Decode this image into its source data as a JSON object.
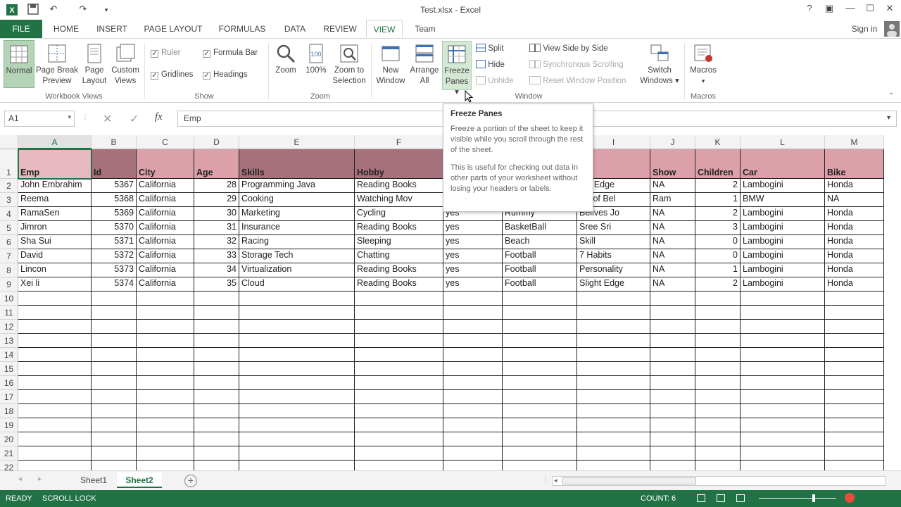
{
  "window": {
    "title": "Test.xlsx - Excel"
  },
  "qat": {
    "undo": "↶",
    "redo": "↷"
  },
  "window_controls": {
    "help": "?",
    "restore_ribbon": "▣",
    "minimize": "—",
    "maximize": "☐",
    "close": "✕"
  },
  "tabs": [
    "FILE",
    "HOME",
    "INSERT",
    "PAGE LAYOUT",
    "FORMULAS",
    "DATA",
    "REVIEW",
    "VIEW",
    "Team"
  ],
  "account": {
    "signin": "Sign in"
  },
  "ribbon": {
    "workbook_views": {
      "label": "Workbook Views",
      "normal": "Normal",
      "page_break_1": "Page Break",
      "page_break_2": "Preview",
      "page_layout_1": "Page",
      "page_layout_2": "Layout",
      "custom_1": "Custom",
      "custom_2": "Views"
    },
    "show": {
      "label": "Show",
      "ruler": "Ruler",
      "formula_bar": "Formula Bar",
      "gridlines": "Gridlines",
      "headings": "Headings"
    },
    "zoom": {
      "label": "Zoom",
      "zoom": "Zoom",
      "hundred": "100%",
      "zoom_sel_1": "Zoom to",
      "zoom_sel_2": "Selection"
    },
    "window": {
      "label": "Window",
      "new_1": "New",
      "new_2": "Window",
      "arrange_1": "Arrange",
      "arrange_2": "All",
      "freeze_1": "Freeze",
      "freeze_2": "Panes ▾",
      "split": "Split",
      "hide": "Hide",
      "unhide": "Unhide",
      "side_by_side": "View Side by Side",
      "sync_scroll": "Synchronous Scrolling",
      "reset_pos": "Reset Window Position",
      "switch_1": "Switch",
      "switch_2": "Windows ▾"
    },
    "macros": {
      "label": "Macros",
      "macros": "Macros",
      "arrow": "▾"
    }
  },
  "formula_bar": {
    "namebox": "A1",
    "fx": "fx",
    "value": "Emp"
  },
  "tooltip": {
    "title": "Freeze Panes",
    "p1": "Freeze a portion of the sheet to keep it visible while you scroll through the rest of the sheet.",
    "p2": "This is useful for checking out data in other parts of your worksheet without losing your headers or labels."
  },
  "columns": [
    "A",
    "B",
    "C",
    "D",
    "E",
    "F",
    "G",
    "H",
    "I",
    "J",
    "K",
    "L",
    "M"
  ],
  "rows": [
    "1",
    "2",
    "3",
    "4",
    "5",
    "6",
    "7",
    "8",
    "9",
    "10",
    "11",
    "12",
    "13",
    "14",
    "15",
    "16",
    "17",
    "18",
    "19",
    "20",
    "21",
    "22"
  ],
  "table": {
    "headers": [
      "Emp",
      "Id",
      "City",
      "Age",
      "Skills",
      "Hobby",
      "",
      "",
      "k",
      "Show",
      "Children",
      "Car",
      "Bike"
    ],
    "data": [
      [
        "John Embrahim",
        "5367",
        "California",
        "28",
        "Programming Java",
        "Reading Books",
        "",
        "",
        "ght Edge",
        "NA",
        "2",
        "Lambogini",
        "Honda"
      ],
      [
        "Reema",
        "5368",
        "California",
        "29",
        "Cooking",
        "Watching Mov",
        "",
        "",
        "gic of Bel",
        "Ram",
        "1",
        "BMW",
        "NA"
      ],
      [
        "RamaSen",
        "5369",
        "California",
        "30",
        "Marketing",
        "Cycling",
        "yes",
        "Rummy",
        "Belives Jo",
        "NA",
        "2",
        "Lambogini",
        "Honda"
      ],
      [
        "Jimron",
        "5370",
        "California",
        "31",
        "Insurance",
        "Reading Books",
        "yes",
        "BasketBall",
        "Sree Sri",
        "NA",
        "3",
        "Lambogini",
        "Honda"
      ],
      [
        "Sha Sui",
        "5371",
        "California",
        "32",
        "Racing",
        "Sleeping",
        "yes",
        "Beach",
        "Skill",
        "NA",
        "0",
        "Lambogini",
        "Honda"
      ],
      [
        "David",
        "5372",
        "California",
        "33",
        "Storage Tech",
        "Chatting",
        "yes",
        "Football",
        "7 Habits",
        "NA",
        "0",
        "Lambogini",
        "Honda"
      ],
      [
        "Lincon",
        "5373",
        "California",
        "34",
        "Virtualization",
        "Reading Books",
        "yes",
        "Football",
        "Personality",
        "NA",
        "1",
        "Lambogini",
        "Honda"
      ],
      [
        "Xei li",
        "5374",
        "California",
        "35",
        "Cloud",
        "Reading Books",
        "yes",
        "Football",
        "Slight Edge",
        "NA",
        "2",
        "Lambogini",
        "Honda"
      ]
    ]
  },
  "sheets": {
    "sheet1": "Sheet1",
    "sheet2": "Sheet2",
    "add": "+"
  },
  "status": {
    "ready": "READY",
    "scroll_lock": "SCROLL LOCK",
    "count": "COUNT: 6"
  },
  "colors": {
    "excel_green": "#217346",
    "header_fill_a": "#e6b8c0",
    "header_fill_b": "#a6717b",
    "header_fill_c": "#dca0ab"
  },
  "icons": [
    "excel-logo-icon",
    "save-icon",
    "undo-icon",
    "redo-icon",
    "customize-qat-icon",
    "help-icon",
    "restore-ribbon-icon",
    "minimize-icon",
    "maximize-icon",
    "close-icon"
  ]
}
